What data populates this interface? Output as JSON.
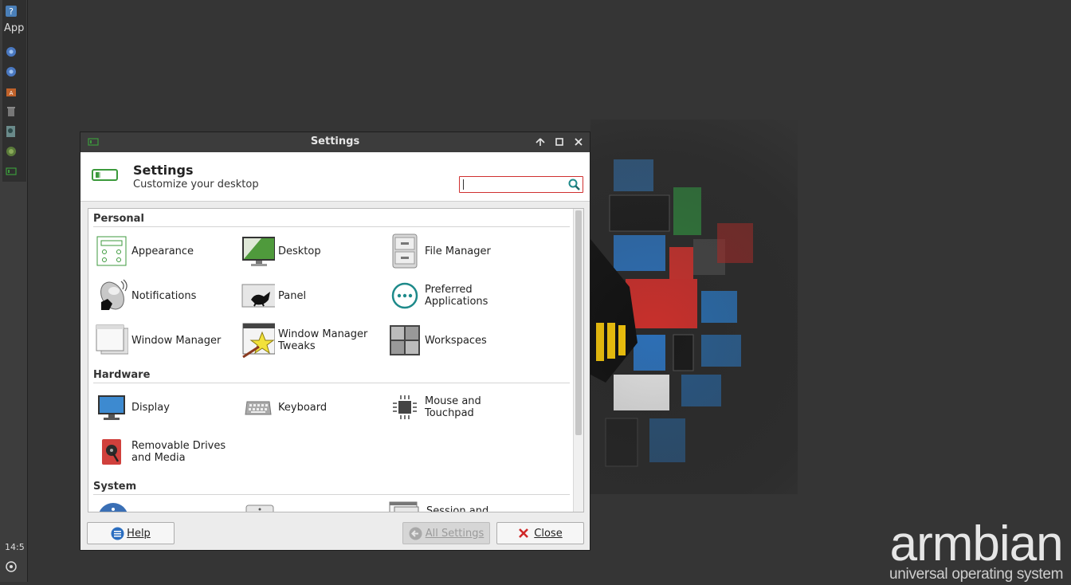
{
  "desktop": {
    "brand": {
      "name": "armbian",
      "tagline": "universal operating system"
    }
  },
  "panel": {
    "app_label": "App",
    "clock": "14:5",
    "launchers": [
      "help-icon",
      "browser-icon",
      "browser-icon",
      "software-center-icon",
      "trash-icon",
      "terminal-icon",
      "network-icon",
      "settings-window-icon"
    ]
  },
  "window": {
    "title": "Settings",
    "header": {
      "title": "Settings",
      "subtitle": "Customize your desktop"
    },
    "search": {
      "value": "",
      "placeholder": ""
    },
    "sections": {
      "personal": {
        "title": "Personal",
        "items": [
          {
            "label": "Appearance",
            "icon": "appearance-icon"
          },
          {
            "label": "Desktop",
            "icon": "desktop-icon"
          },
          {
            "label": "File Manager",
            "icon": "file-manager-icon"
          },
          {
            "label": "Notifications",
            "icon": "notifications-icon"
          },
          {
            "label": "Panel",
            "icon": "panel-icon"
          },
          {
            "label": "Preferred Applications",
            "line1": "Preferred",
            "line2": "Applications",
            "icon": "preferred-apps-icon"
          },
          {
            "label": "Window Manager",
            "icon": "window-manager-icon"
          },
          {
            "label": "Window Manager Tweaks",
            "line1": "Window Manager",
            "line2": "Tweaks",
            "icon": "wm-tweaks-icon"
          },
          {
            "label": "Workspaces",
            "icon": "workspaces-icon"
          }
        ]
      },
      "hardware": {
        "title": "Hardware",
        "items": [
          {
            "label": "Display",
            "icon": "display-icon"
          },
          {
            "label": "Keyboard",
            "icon": "keyboard-icon"
          },
          {
            "label": "Mouse and Touchpad",
            "line1": "Mouse and",
            "line2": "Touchpad",
            "icon": "mouse-icon"
          },
          {
            "label": "Removable Drives and Media",
            "line1": "Removable Drives",
            "line2": "and Media",
            "icon": "removable-drives-icon"
          }
        ]
      },
      "system": {
        "title": "System",
        "items": [
          {
            "label": "Session and",
            "icon": "session-icon"
          }
        ]
      }
    },
    "footer": {
      "help_label": "Help",
      "all_settings_label": "All Settings",
      "close_label": "Close"
    },
    "colors": {
      "accent": "#3c9a3c",
      "search_border": "#d03030",
      "titlebar": "#3c3c3c"
    }
  }
}
